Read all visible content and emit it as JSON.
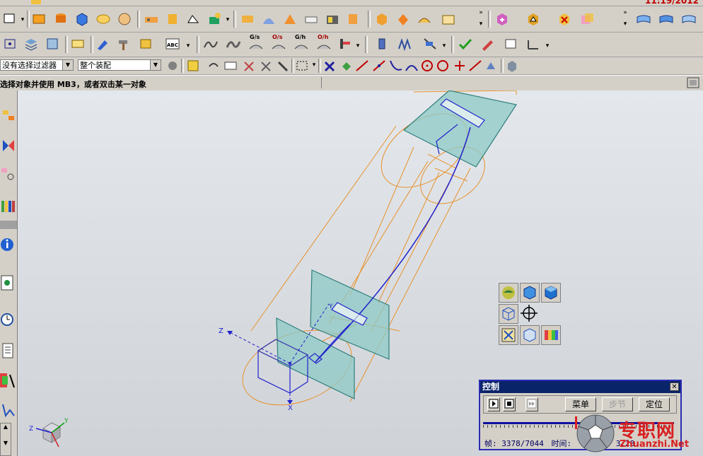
{
  "clock": "11:19/2012",
  "filter": {
    "type_filter": "没有选择过滤器",
    "scope": "整个装配"
  },
  "status_prompt": "选择对象并使用 MB3，或者双击某一对象",
  "toolbar_text_icons": {
    "gs": "G/s",
    "os": "O/s",
    "gh": "G/h",
    "oh": "O/h",
    "abc": "ABC"
  },
  "triad": {
    "label_z": "Z",
    "label_y": "Y",
    "label_x": "X"
  },
  "wcs": {
    "label_z": "Z",
    "label_y": "Y",
    "label_x": "X"
  },
  "control": {
    "title": "控制",
    "close": "✕",
    "menu_label": "菜单",
    "step_label": "步节",
    "locate_label": "定位",
    "frame_label": "帧:",
    "frame_value": "3378/7044",
    "time_label": "时间:",
    "time_value": "3:28",
    "progress": 0.48
  },
  "watermark": {
    "site": "专职网",
    "url": "Zhuanzhi.Net"
  },
  "colors": {
    "edge_orange": "#e8902a",
    "axis_blue": "#2222cc",
    "plate_fill": "#8ec9c7",
    "plate_edge": "#2f7f7c",
    "title_blue": "#0a246a",
    "watermark_red": "#d82020"
  }
}
